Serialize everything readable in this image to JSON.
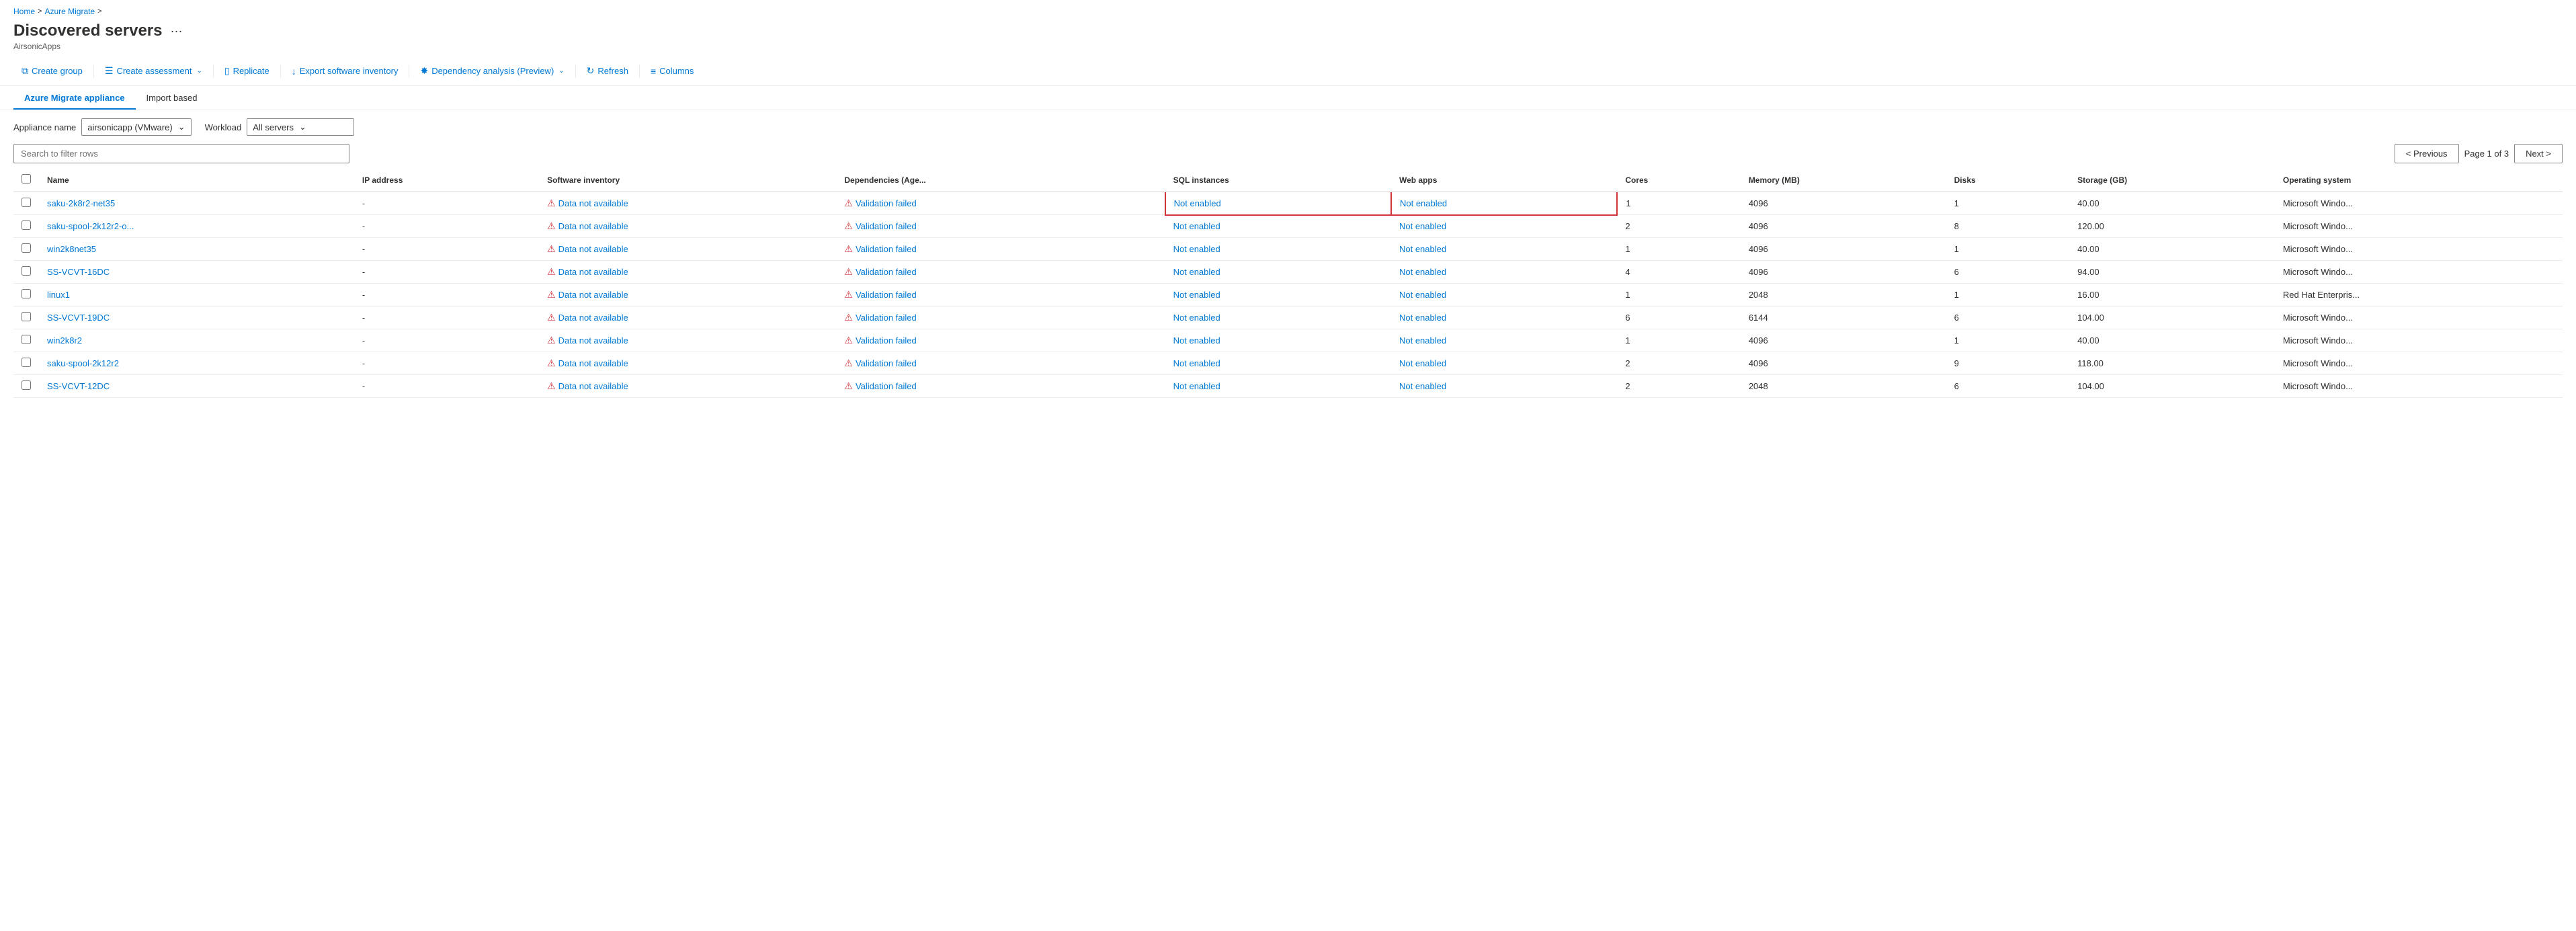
{
  "breadcrumb": {
    "home": "Home",
    "azure_migrate": "Azure Migrate",
    "sep1": ">",
    "sep2": ">"
  },
  "page": {
    "title": "Discovered servers",
    "subtitle": "AirsonicApps",
    "ellipsis": "···"
  },
  "toolbar": {
    "create_group": "Create group",
    "create_assessment": "Create assessment",
    "replicate": "Replicate",
    "export_software": "Export software inventory",
    "dependency_analysis": "Dependency analysis (Preview)",
    "refresh": "Refresh",
    "columns": "Columns"
  },
  "tabs": [
    {
      "label": "Azure Migrate appliance",
      "active": true
    },
    {
      "label": "Import based",
      "active": false
    }
  ],
  "filters": {
    "appliance_label": "Appliance name",
    "appliance_value": "airsonicapp (VMware)",
    "workload_label": "Workload",
    "workload_value": "All servers"
  },
  "search": {
    "placeholder": "Search to filter rows"
  },
  "pagination": {
    "previous": "< Previous",
    "next": "Next >",
    "page_info": "Page 1 of 3"
  },
  "table": {
    "columns": [
      {
        "key": "name",
        "label": "Name"
      },
      {
        "key": "ip",
        "label": "IP address"
      },
      {
        "key": "software",
        "label": "Software inventory"
      },
      {
        "key": "dependencies",
        "label": "Dependencies (Age..."
      },
      {
        "key": "sql",
        "label": "SQL instances"
      },
      {
        "key": "webapps",
        "label": "Web apps"
      },
      {
        "key": "cores",
        "label": "Cores"
      },
      {
        "key": "memory",
        "label": "Memory (MB)"
      },
      {
        "key": "disks",
        "label": "Disks"
      },
      {
        "key": "storage",
        "label": "Storage (GB)"
      },
      {
        "key": "os",
        "label": "Operating system"
      }
    ],
    "rows": [
      {
        "name": "saku-2k8r2-net35",
        "ip": "-",
        "software_text": "Data not available",
        "dep_text": "Validation failed",
        "sql": "Not enabled",
        "web": "Not enabled",
        "cores": "1",
        "memory": "4096",
        "disks": "1",
        "storage": "40.00",
        "os": "Microsoft Windo...",
        "sql_highlight": true
      },
      {
        "name": "saku-spool-2k12r2-o...",
        "ip": "-",
        "software_text": "Data not available",
        "dep_text": "Validation failed",
        "sql": "Not enabled",
        "web": "Not enabled",
        "cores": "2",
        "memory": "4096",
        "disks": "8",
        "storage": "120.00",
        "os": "Microsoft Windo...",
        "sql_highlight": false
      },
      {
        "name": "win2k8net35",
        "ip": "-",
        "software_text": "Data not available",
        "dep_text": "Validation failed",
        "sql": "Not enabled",
        "web": "Not enabled",
        "cores": "1",
        "memory": "4096",
        "disks": "1",
        "storage": "40.00",
        "os": "Microsoft Windo...",
        "sql_highlight": false
      },
      {
        "name": "SS-VCVT-16DC",
        "ip": "-",
        "software_text": "Data not available",
        "dep_text": "Validation failed",
        "sql": "Not enabled",
        "web": "Not enabled",
        "cores": "4",
        "memory": "4096",
        "disks": "6",
        "storage": "94.00",
        "os": "Microsoft Windo...",
        "sql_highlight": false
      },
      {
        "name": "linux1",
        "ip": "-",
        "software_text": "Data not available",
        "dep_text": "Validation failed",
        "sql": "Not enabled",
        "web": "Not enabled",
        "cores": "1",
        "memory": "2048",
        "disks": "1",
        "storage": "16.00",
        "os": "Red Hat Enterpris...",
        "sql_highlight": false
      },
      {
        "name": "SS-VCVT-19DC",
        "ip": "-",
        "software_text": "Data not available",
        "dep_text": "Validation failed",
        "sql": "Not enabled",
        "web": "Not enabled",
        "cores": "6",
        "memory": "6144",
        "disks": "6",
        "storage": "104.00",
        "os": "Microsoft Windo...",
        "sql_highlight": false
      },
      {
        "name": "win2k8r2",
        "ip": "-",
        "software_text": "Data not available",
        "dep_text": "Validation failed",
        "sql": "Not enabled",
        "web": "Not enabled",
        "cores": "1",
        "memory": "4096",
        "disks": "1",
        "storage": "40.00",
        "os": "Microsoft Windo...",
        "sql_highlight": false
      },
      {
        "name": "saku-spool-2k12r2",
        "ip": "-",
        "software_text": "Data not available",
        "dep_text": "Validation failed",
        "sql": "Not enabled",
        "web": "Not enabled",
        "cores": "2",
        "memory": "4096",
        "disks": "9",
        "storage": "118.00",
        "os": "Microsoft Windo...",
        "sql_highlight": false
      },
      {
        "name": "SS-VCVT-12DC",
        "ip": "-",
        "software_text": "Data not available",
        "dep_text": "Validation failed",
        "sql": "Not enabled",
        "web": "Not enabled",
        "cores": "2",
        "memory": "2048",
        "disks": "6",
        "storage": "104.00",
        "os": "Microsoft Windo...",
        "sql_highlight": false
      }
    ]
  }
}
